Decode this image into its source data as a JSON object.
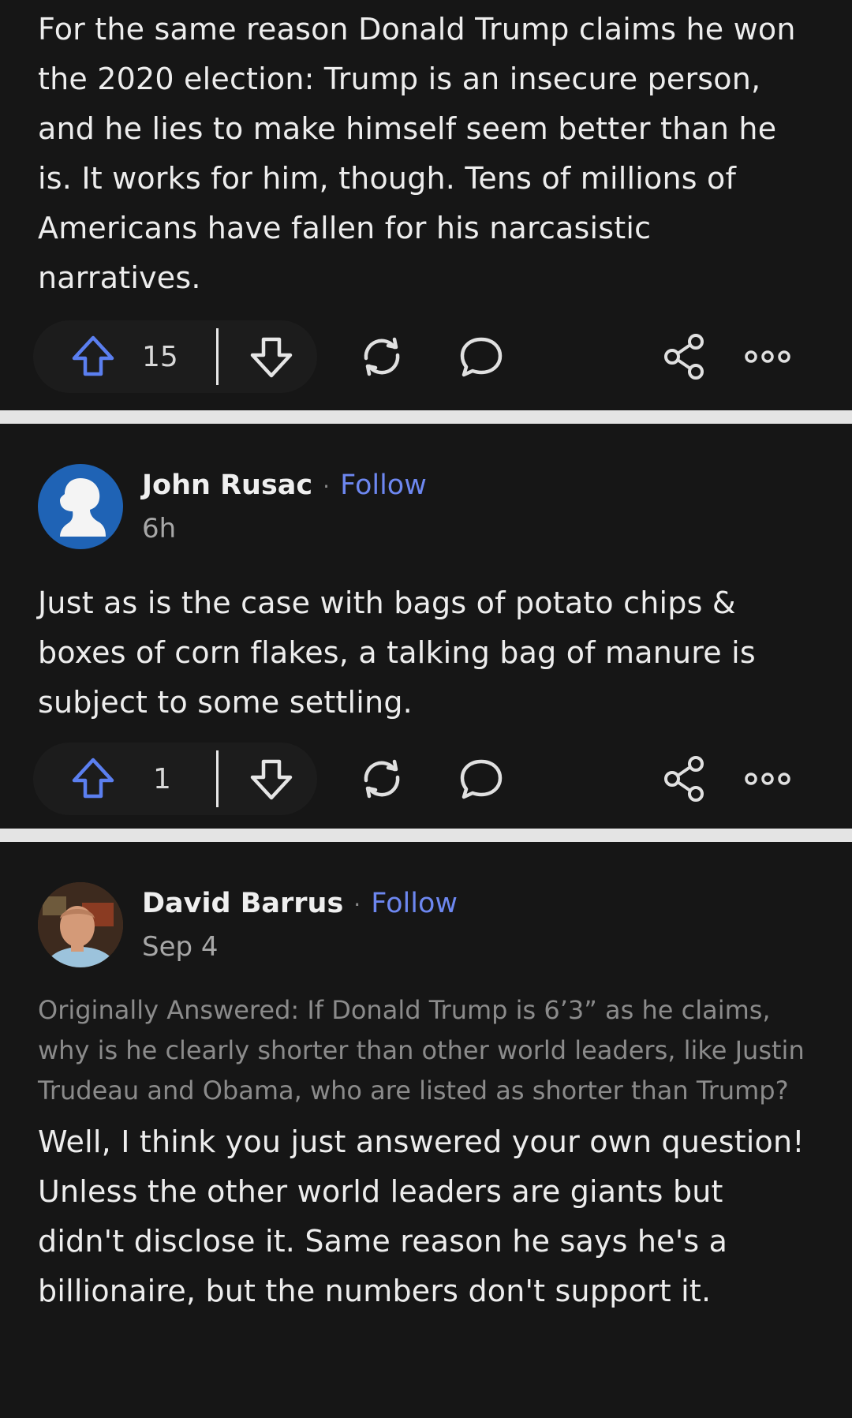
{
  "posts": [
    {
      "body": "For the same reason Donald Trump claims he won the 2020 election: Trump is an insecure person, and he lies to make himself seem better than he is. It works for him, though. Tens of millions of Americans have fallen for his narcasistic narratives.",
      "upvotes": "15"
    },
    {
      "author": "John Rusac",
      "follow_label": "Follow",
      "timestamp": "6h",
      "body": "Just as is the case with bags of potato chips & boxes of corn flakes, a talking bag of manure is subject to some settling.",
      "upvotes": "1"
    },
    {
      "author": "David Barrus",
      "follow_label": "Follow",
      "timestamp": "Sep 4",
      "originally_answered": "Originally Answered: If Donald Trump is 6’3” as he claims, why is he clearly shorter than other world leaders, like Justin Trudeau and Obama, who are listed as shorter than Trump?",
      "body": "Well, I think you just answered your own question! Unless the other world leaders are giants but didn't disclose it. Same reason he says he's a billionaire, but the numbers don't support it."
    }
  ],
  "separator_dot": "·",
  "colors": {
    "background": "#161616",
    "divider": "#e4e4e4",
    "accent": "#6d87f0",
    "upvote_icon": "#5b7ff0",
    "muted_text": "#8b8b8b"
  },
  "icons": [
    "upvote-icon",
    "downvote-icon",
    "share-reshare-icon",
    "comment-icon",
    "share-icon",
    "more-options-icon",
    "default-avatar-icon"
  ]
}
